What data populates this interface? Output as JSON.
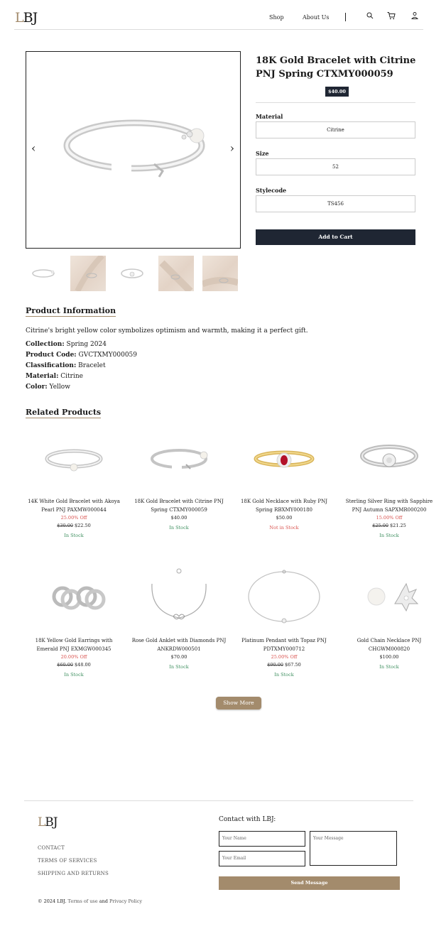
{
  "header": {
    "logo_first": "L",
    "logo_rest": "BJ",
    "nav": [
      "Shop",
      "About Us"
    ],
    "icons": [
      "search-icon",
      "cart-icon",
      "user-icon"
    ]
  },
  "gallery": {
    "prev_arrow": "‹",
    "next_arrow": "›"
  },
  "product": {
    "title": "18K Gold Bracelet with Citrine PNJ Spring CTXMY000059",
    "price": "$40.00",
    "fields": [
      {
        "label": "Material",
        "value": "Citrine"
      },
      {
        "label": "Size",
        "value": "52"
      },
      {
        "label": "Stylecode",
        "value": "TS456"
      }
    ],
    "add_to_cart": "Add to Cart"
  },
  "info": {
    "heading": "Product Information",
    "description": "Citrine's bright yellow color symbolizes optimism and warmth, making it a perfect gift.",
    "specs": [
      {
        "label": "Collection:",
        "value": "Spring 2024"
      },
      {
        "label": "Product Code:",
        "value": "GVCTXMY000059"
      },
      {
        "label": "Classification:",
        "value": "Bracelet"
      },
      {
        "label": "Material:",
        "value": "Citrine"
      },
      {
        "label": "Color:",
        "value": "Yellow"
      }
    ]
  },
  "related": {
    "heading": "Related Products",
    "items": [
      {
        "name": "14K White Gold Bracelet with Akoya Pearl PNJ PAXMW000044",
        "discount": "25.00% Off",
        "old_price": "$30.00",
        "price": "$22.50",
        "stock": "In Stock",
        "in_stock": true,
        "icon": "bracelet-pearl-image"
      },
      {
        "name": "18K Gold Bracelet with Citrine PNJ Spring CTXMY000059",
        "discount": "",
        "old_price": "",
        "price": "$40.00",
        "stock": "In Stock",
        "in_stock": true,
        "icon": "bracelet-open-image"
      },
      {
        "name": "18K Gold Necklace with Ruby PNJ Spring RBXMY000180",
        "discount": "",
        "old_price": "",
        "price": "$50.00",
        "stock": "Not in Stock",
        "in_stock": false,
        "icon": "ruby-ring-image"
      },
      {
        "name": "Sterling Silver Ring with Sapphire PNJ Autumn SAPXMR000200",
        "discount": "15.00% Off",
        "old_price": "$25.00",
        "price": "$21.25",
        "stock": "In Stock",
        "in_stock": true,
        "icon": "silver-bangle-image"
      },
      {
        "name": "18K Yellow Gold Earrings with Emerald PNJ EXMGW000345",
        "discount": "20.00% Off",
        "old_price": "$60.00",
        "price": "$48.00",
        "stock": "In Stock",
        "in_stock": true,
        "icon": "hoop-earrings-image"
      },
      {
        "name": "Rose Gold Anklet with Diamonds PNJ ANKRDW000501",
        "discount": "",
        "old_price": "",
        "price": "$70.00",
        "stock": "In Stock",
        "in_stock": true,
        "icon": "anklet-image"
      },
      {
        "name": "Platinum Pendant with Topaz PNJ PDTXMY000712",
        "discount": "25.00% Off",
        "old_price": "$90.00",
        "price": "$67.50",
        "stock": "In Stock",
        "in_stock": true,
        "icon": "pendant-chain-image"
      },
      {
        "name": "Gold Chain Necklace PNJ CHGWM000820",
        "discount": "",
        "old_price": "",
        "price": "$100.00",
        "stock": "In Stock",
        "in_stock": true,
        "icon": "pearl-earrings-image"
      }
    ],
    "show_more": "Show More"
  },
  "footer": {
    "logo_first": "L",
    "logo_rest": "BJ",
    "links": [
      "CONTACT",
      "TERMS OF SERVICES",
      "SHIPPING AND RETURNS"
    ],
    "copyright_prefix": "© 2024 LBJ.",
    "terms": "Terms of use",
    "and": "and",
    "privacy": "Privacy Policy",
    "contact_title": "Contact with LBJ:",
    "name_placeholder": "Your Name",
    "email_placeholder": "Your Email",
    "message_placeholder": "Your Message",
    "send": "Send Message"
  },
  "colors": {
    "accent": "#a38b6c",
    "dark": "#1f2633",
    "in_stock": "#3e8f5f",
    "out_stock": "#d9534f"
  }
}
